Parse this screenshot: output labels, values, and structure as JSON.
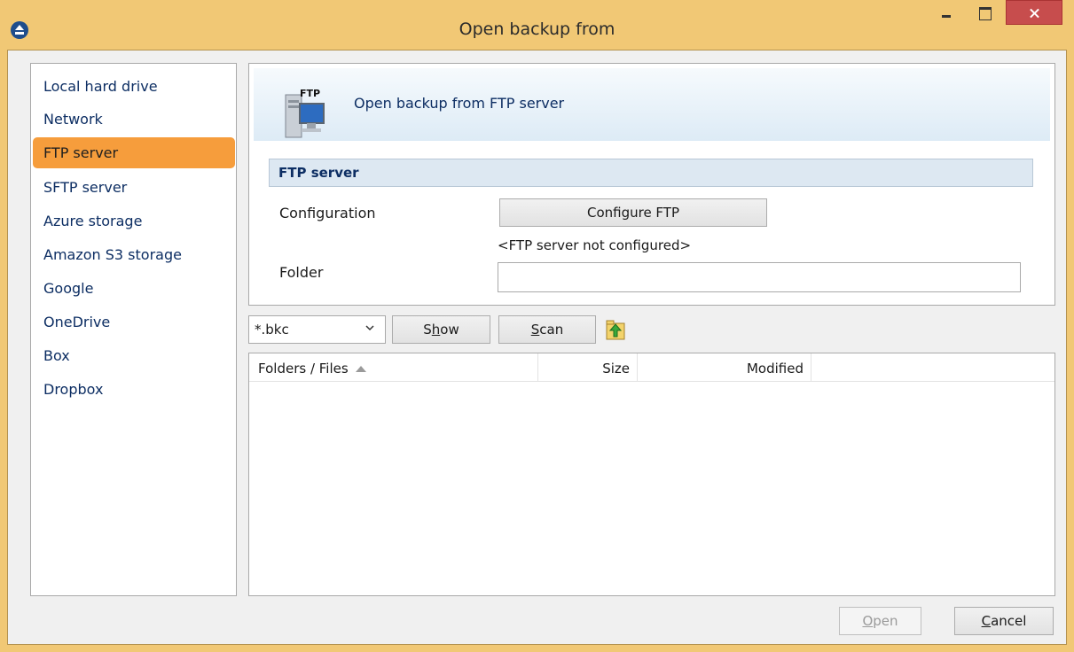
{
  "window": {
    "title": "Open backup from"
  },
  "sidebar": {
    "items": [
      {
        "label": "Local hard drive",
        "active": false
      },
      {
        "label": "Network",
        "active": false
      },
      {
        "label": "FTP server",
        "active": true
      },
      {
        "label": "SFTP server",
        "active": false
      },
      {
        "label": "Azure storage",
        "active": false
      },
      {
        "label": "Amazon S3 storage",
        "active": false
      },
      {
        "label": "Google",
        "active": false
      },
      {
        "label": "OneDrive",
        "active": false
      },
      {
        "label": "Box",
        "active": false
      },
      {
        "label": "Dropbox",
        "active": false
      }
    ]
  },
  "header": {
    "icon_text": "FTP",
    "title": "Open backup from FTP server"
  },
  "ftp_section": {
    "title": "FTP server",
    "configuration_label": "Configuration",
    "configure_button": "Configure FTP",
    "status": "<FTP server not configured>",
    "folder_label": "Folder",
    "folder_value": ""
  },
  "toolbar": {
    "filter_value": "*.bkc",
    "show_prefix": "S",
    "show_accel": "h",
    "show_suffix": "ow",
    "scan_accel": "S",
    "scan_suffix": "can"
  },
  "file_list": {
    "columns": {
      "name": "Folders / Files",
      "size": "Size",
      "modified": "Modified"
    },
    "rows": []
  },
  "footer": {
    "open_accel": "O",
    "open_suffix": "pen",
    "cancel_accel": "C",
    "cancel_suffix": "ancel"
  },
  "colors": {
    "titlebar": "#f1c875",
    "active_item": "#f69d3c",
    "link_text": "#0d2e63",
    "close_button": "#c74d4d"
  },
  "icons": [
    "app-logo-icon",
    "minimize-icon",
    "maximize-icon",
    "close-icon",
    "ftp-server-icon",
    "chevron-down-icon",
    "folder-up-icon",
    "sort-ascending-icon"
  ]
}
